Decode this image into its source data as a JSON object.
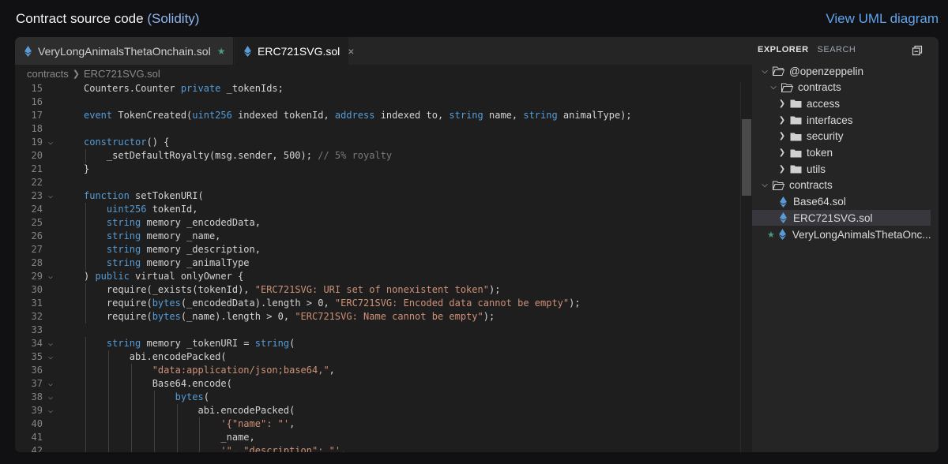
{
  "page": {
    "title": "Contract source code",
    "language": "(Solidity)",
    "uml_link": "View UML diagram"
  },
  "colors": {
    "accent": "#5fa4ee",
    "keyword": "#569cd6",
    "string": "#ce9178",
    "star": "#4a9c7c",
    "ethereum_icon": "#5b9bd5"
  },
  "editor": {
    "tabs": [
      {
        "label": "VeryLongAnimalsThetaOnchain.sol",
        "icon": "ethereum-icon",
        "starred": true,
        "active": false
      },
      {
        "label": "ERC721SVG.sol",
        "icon": "ethereum-icon",
        "active": true,
        "close": "×"
      }
    ],
    "breadcrumb": [
      "contracts",
      "ERC721SVG.sol"
    ]
  },
  "code": {
    "lines": [
      {
        "n": "15",
        "fold": false,
        "t": "Counters.Counter private _tokenIds;"
      },
      {
        "n": "16",
        "fold": false,
        "t": ""
      },
      {
        "n": "17",
        "fold": false,
        "t": "event TokenCreated(uint256 indexed tokenId, address indexed to, string name, string animalType);"
      },
      {
        "n": "18",
        "fold": false,
        "t": ""
      },
      {
        "n": "19",
        "fold": true,
        "t": "constructor() {"
      },
      {
        "n": "20",
        "fold": false,
        "t": "    _setDefaultRoyalty(msg.sender, 500); // 5% royalty"
      },
      {
        "n": "21",
        "fold": false,
        "t": "}"
      },
      {
        "n": "22",
        "fold": false,
        "t": ""
      },
      {
        "n": "23",
        "fold": true,
        "t": "function setTokenURI("
      },
      {
        "n": "24",
        "fold": false,
        "t": "    uint256 tokenId,"
      },
      {
        "n": "25",
        "fold": false,
        "t": "    string memory _encodedData,"
      },
      {
        "n": "26",
        "fold": false,
        "t": "    string memory _name,"
      },
      {
        "n": "27",
        "fold": false,
        "t": "    string memory _description,"
      },
      {
        "n": "28",
        "fold": false,
        "t": "    string memory _animalType"
      },
      {
        "n": "29",
        "fold": true,
        "t": ") public virtual onlyOwner {"
      },
      {
        "n": "30",
        "fold": false,
        "t": "    require(_exists(tokenId), \"ERC721SVG: URI set of nonexistent token\");"
      },
      {
        "n": "31",
        "fold": false,
        "t": "    require(bytes(_encodedData).length > 0, \"ERC721SVG: Encoded data cannot be empty\");"
      },
      {
        "n": "32",
        "fold": false,
        "t": "    require(bytes(_name).length > 0, \"ERC721SVG: Name cannot be empty\");"
      },
      {
        "n": "33",
        "fold": false,
        "t": ""
      },
      {
        "n": "34",
        "fold": true,
        "t": "    string memory _tokenURI = string("
      },
      {
        "n": "35",
        "fold": true,
        "t": "        abi.encodePacked("
      },
      {
        "n": "36",
        "fold": false,
        "t": "            \"data:application/json;base64,\","
      },
      {
        "n": "37",
        "fold": true,
        "t": "            Base64.encode("
      },
      {
        "n": "38",
        "fold": true,
        "t": "                bytes("
      },
      {
        "n": "39",
        "fold": true,
        "t": "                    abi.encodePacked("
      },
      {
        "n": "40",
        "fold": false,
        "t": "                        '{\"name\": \"',"
      },
      {
        "n": "41",
        "fold": false,
        "t": "                        _name,"
      },
      {
        "n": "42",
        "fold": false,
        "t": "                        '\", \"description\": \"',"
      }
    ]
  },
  "explorer": {
    "tabs": [
      "EXPLORER",
      "SEARCH"
    ],
    "tree": [
      {
        "label": "@openzeppelin",
        "type": "folder",
        "open": true,
        "depth": 0
      },
      {
        "label": "contracts",
        "type": "folder",
        "open": true,
        "depth": 1
      },
      {
        "label": "access",
        "type": "folder",
        "open": false,
        "depth": 2
      },
      {
        "label": "interfaces",
        "type": "folder",
        "open": false,
        "depth": 2
      },
      {
        "label": "security",
        "type": "folder",
        "open": false,
        "depth": 2
      },
      {
        "label": "token",
        "type": "folder",
        "open": false,
        "depth": 2
      },
      {
        "label": "utils",
        "type": "folder",
        "open": false,
        "depth": 2
      },
      {
        "label": "contracts",
        "type": "folder",
        "open": true,
        "depth": 0
      },
      {
        "label": "Base64.sol",
        "type": "file",
        "depth": 1
      },
      {
        "label": "ERC721SVG.sol",
        "type": "file",
        "depth": 1,
        "selected": true
      },
      {
        "label": "VeryLongAnimalsThetaOnc...",
        "type": "file",
        "depth": 1,
        "starred": true
      }
    ]
  }
}
